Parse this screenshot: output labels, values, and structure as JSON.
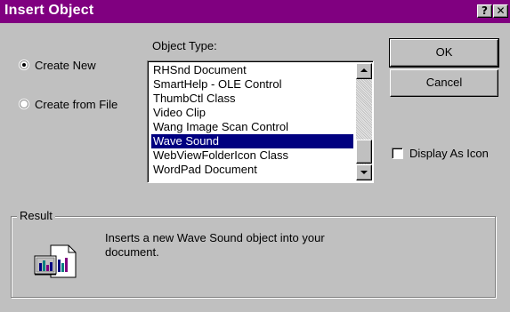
{
  "window": {
    "title": "Insert Object",
    "help_glyph": "?",
    "close_glyph": "✕"
  },
  "options": {
    "create_new": {
      "label": "Create New",
      "selected": true
    },
    "create_from_file": {
      "label": "Create from File",
      "selected": false
    }
  },
  "object_type": {
    "label": "Object Type:",
    "items": [
      "RHSnd Document",
      "SmartHelp - OLE Control",
      "ThumbCtl Class",
      "Video Clip",
      "Wang Image Scan Control",
      "Wave Sound",
      "WebViewFolderIcon Class",
      "WordPad Document"
    ],
    "selected": "Wave Sound"
  },
  "buttons": {
    "ok": "OK",
    "cancel": "Cancel"
  },
  "display_as_icon": {
    "label": "Display As Icon",
    "checked": false
  },
  "result": {
    "legend": "Result",
    "text": "Inserts a new Wave Sound object into your document.",
    "icon": "insert-object-result-icon"
  },
  "colors": {
    "titlebar": "#800080",
    "selection": "#000080",
    "face": "#c0c0c0"
  }
}
